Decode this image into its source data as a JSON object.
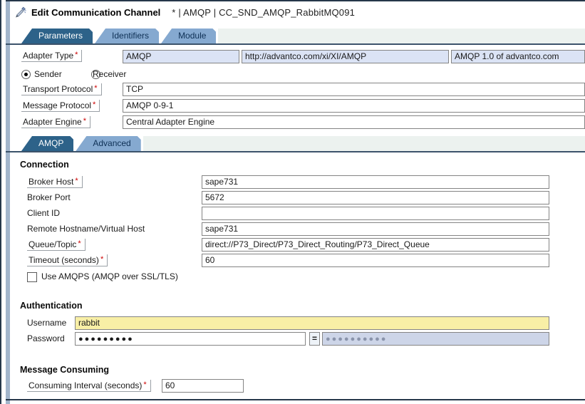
{
  "required_marker": "*",
  "window": {
    "title": "Edit Communication Channel",
    "subtitle": "* | AMQP | CC_SND_AMQP_RabbitMQ091"
  },
  "tabs": [
    {
      "label": "Parameters",
      "active": true
    },
    {
      "label": "Identifiers",
      "active": false
    },
    {
      "label": "Module",
      "active": false
    }
  ],
  "parameters": {
    "adapter_type": {
      "label": "Adapter Type",
      "name": "AMQP",
      "namespace": "http://advantco.com/xi/XI/AMQP",
      "vendor": "AMQP 1.0 of advantco.com"
    },
    "direction": {
      "sender_label": "Sender",
      "receiver_label": "Receiver",
      "selected": "Sender"
    },
    "transport_protocol": {
      "label": "Transport Protocol",
      "value": "TCP"
    },
    "message_protocol": {
      "label": "Message Protocol",
      "value": "AMQP 0-9-1"
    },
    "adapter_engine": {
      "label": "Adapter Engine",
      "value": "Central Adapter Engine"
    }
  },
  "subtabs": [
    {
      "label": "AMQP",
      "active": true
    },
    {
      "label": "Advanced",
      "active": false
    }
  ],
  "connection": {
    "heading": "Connection",
    "fields": [
      {
        "label": "Broker Host",
        "required": true,
        "value": "sape731"
      },
      {
        "label": "Broker Port",
        "required": false,
        "value": "5672"
      },
      {
        "label": "Client ID",
        "required": false,
        "value": ""
      },
      {
        "label": "Remote Hostname/Virtual Host",
        "required": false,
        "value": "sape731"
      },
      {
        "label": "Queue/Topic",
        "required": true,
        "value": "direct://P73_Direct/P73_Direct_Routing/P73_Direct_Queue"
      },
      {
        "label": "Timeout (seconds)",
        "required": true,
        "value": "60"
      }
    ],
    "amqps_checkbox": {
      "label": "Use AMQPS (AMQP over SSL/TLS)",
      "checked": false
    }
  },
  "authentication": {
    "heading": "Authentication",
    "username": {
      "label": "Username",
      "value": "rabbit"
    },
    "password": {
      "label": "Password",
      "masked": "●●●●●●●●●",
      "equals": "=",
      "confirm_masked": "●●●●●●●●●●"
    }
  },
  "message_consuming": {
    "heading": "Message Consuming",
    "interval": {
      "label": "Consuming Interval (seconds)",
      "value": "60"
    }
  },
  "colors": {
    "active_tab": "#2d6289",
    "inactive_tab": "#85a9d0",
    "tab_strip_fill": "#ecf2ef",
    "frame_line": "#26374a",
    "readonly_field_bg": "#dbe3f5",
    "username_highlight_bg": "#f8efa6",
    "disabled_field_bg": "#cdd5e8",
    "required_asterisk": "#cc0000"
  }
}
